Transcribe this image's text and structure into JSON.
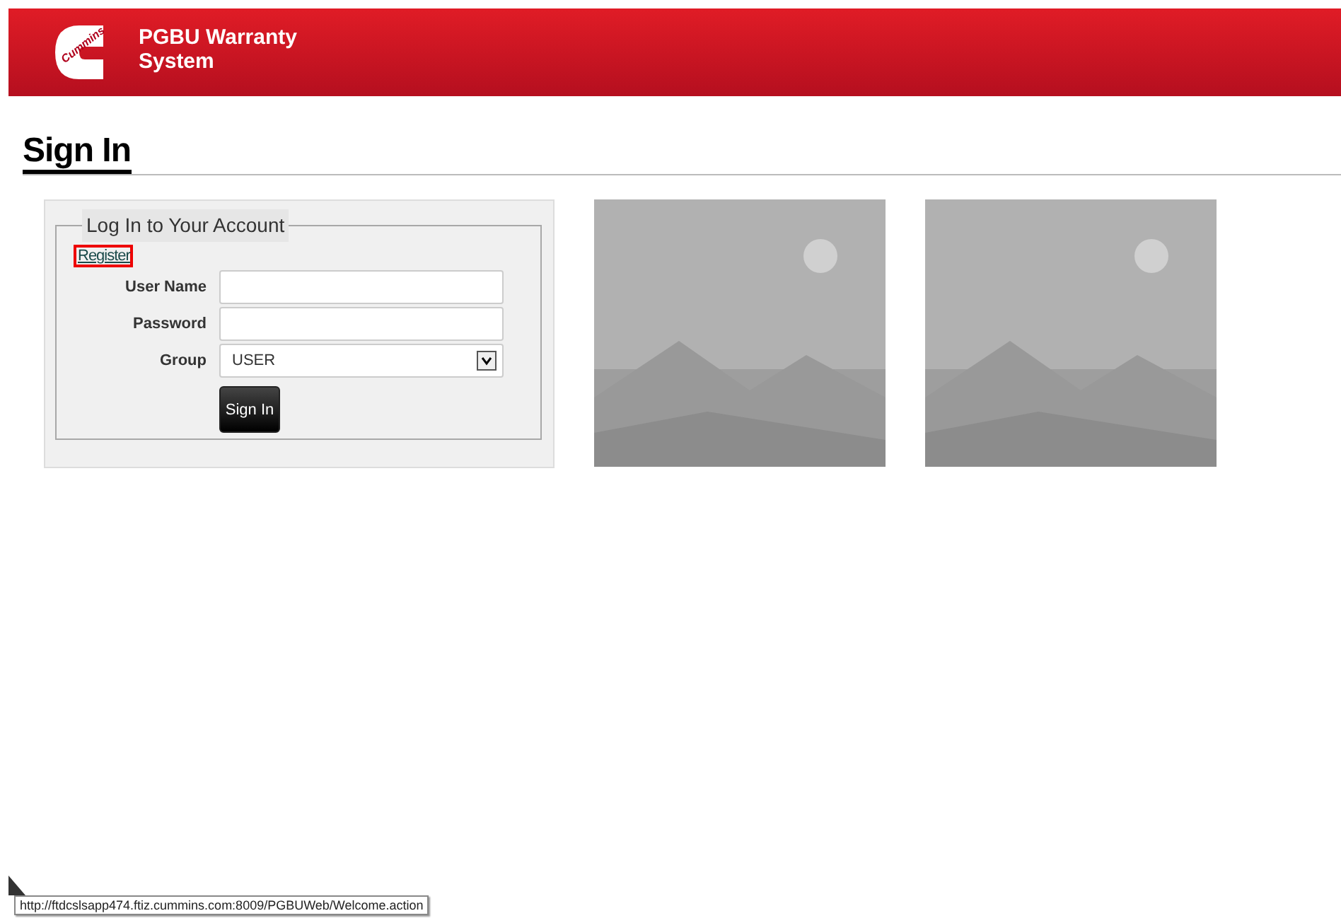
{
  "header": {
    "logo_text": "Cummins",
    "title_line_1": "PGBU Warranty",
    "title_line_2": "System"
  },
  "page_title": "Sign In",
  "login": {
    "legend": "Log In to Your Account",
    "register_link": "Register",
    "fields": [
      {
        "kind": "text",
        "label": "User Name"
      },
      {
        "kind": "password",
        "label": "Password"
      },
      {
        "kind": "select",
        "label": "Group",
        "value": "USER"
      }
    ],
    "submit": "Sign In"
  },
  "status_bar": {
    "url": "http://ftdcslsapp474.ftiz.cummins.com:8009/PGBUWeb/Welcome.action"
  }
}
